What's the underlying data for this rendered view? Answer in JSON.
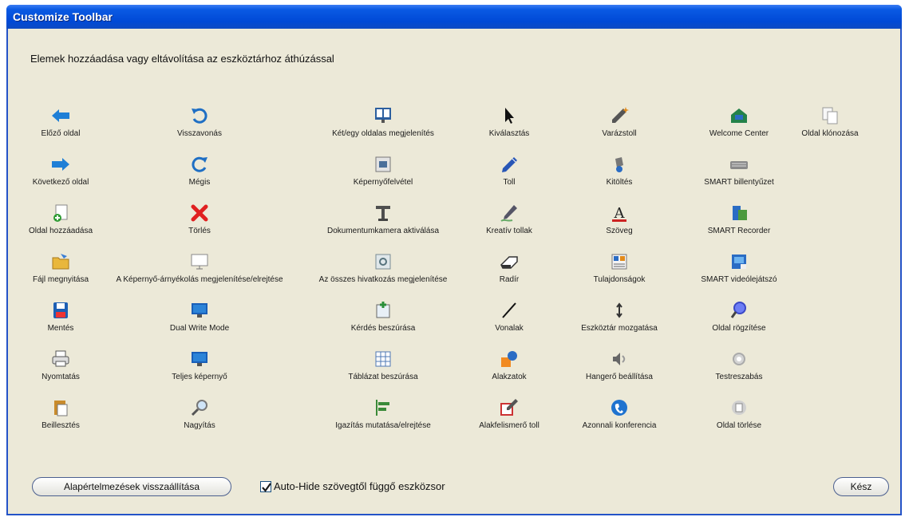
{
  "window": {
    "title": "Customize Toolbar"
  },
  "instruction": "Elemek hozzáadása vagy eltávolítása az eszköztárhoz áthúzással",
  "columns": [
    [
      {
        "label": "Előző oldal",
        "icon": "arrow-left-icon"
      },
      {
        "label": "Következő oldal",
        "icon": "arrow-right-icon"
      },
      {
        "label": "Oldal hozzáadása",
        "icon": "add-page-icon"
      },
      {
        "label": "Fájl megnyitása",
        "icon": "open-folder-icon"
      },
      {
        "label": "Mentés",
        "icon": "save-icon"
      },
      {
        "label": "Nyomtatás",
        "icon": "printer-icon"
      },
      {
        "label": "Beillesztés",
        "icon": "paste-icon"
      }
    ],
    [
      {
        "label": "Visszavonás",
        "icon": "undo-icon"
      },
      {
        "label": "Mégis",
        "icon": "redo-icon"
      },
      {
        "label": "Törlés",
        "icon": "delete-x-icon"
      },
      {
        "label": "A Képernyő-árnyékolás megjelenítése/elrejtése",
        "icon": "screen-shade-icon"
      },
      {
        "label": "Dual Write Mode",
        "icon": "dual-monitor-icon"
      },
      {
        "label": "Teljes képernyő",
        "icon": "full-screen-icon"
      },
      {
        "label": "Nagyítás",
        "icon": "magnifier-icon"
      }
    ],
    [
      {
        "label": "Két/egy oldalas megjelenítés",
        "icon": "dual-page-display-icon"
      },
      {
        "label": "Képernyőfelvétel",
        "icon": "screen-capture-icon"
      },
      {
        "label": "Dokumentumkamera aktiválása",
        "icon": "document-camera-icon"
      },
      {
        "label": "Az összes hivatkozás megjelenítése",
        "icon": "show-links-icon"
      },
      {
        "label": "Kérdés beszúrása",
        "icon": "insert-question-icon"
      },
      {
        "label": "Táblázat beszúrása",
        "icon": "insert-table-icon"
      },
      {
        "label": "Igazítás mutatása/elrejtése",
        "icon": "alignment-icon"
      }
    ],
    [
      {
        "label": "Kiválasztás",
        "icon": "select-arrow-icon"
      },
      {
        "label": "Toll",
        "icon": "pen-icon"
      },
      {
        "label": "Kreatív tollak",
        "icon": "creative-pen-icon"
      },
      {
        "label": "Radír",
        "icon": "eraser-icon"
      },
      {
        "label": "Vonalak",
        "icon": "line-icon"
      },
      {
        "label": "Alakzatok",
        "icon": "shapes-icon"
      },
      {
        "label": "Alakfelismerő toll",
        "icon": "shape-recognition-pen-icon"
      }
    ],
    [
      {
        "label": "Varázstoll",
        "icon": "magic-pen-icon"
      },
      {
        "label": "Kitöltés",
        "icon": "fill-icon"
      },
      {
        "label": "Szöveg",
        "icon": "text-icon"
      },
      {
        "label": "Tulajdonságok",
        "icon": "properties-icon"
      },
      {
        "label": "Eszköztár mozgatása",
        "icon": "move-toolbar-icon"
      },
      {
        "label": "Hangerő beállítása",
        "icon": "volume-icon"
      },
      {
        "label": "Azonnali konferencia",
        "icon": "instant-conference-icon"
      }
    ],
    [
      {
        "label": "Welcome Center",
        "icon": "welcome-center-icon"
      },
      {
        "label": "SMART billentyűzet",
        "icon": "keyboard-icon"
      },
      {
        "label": "SMART Recorder",
        "icon": "recorder-icon"
      },
      {
        "label": "SMART videólejátszó",
        "icon": "video-player-icon"
      },
      {
        "label": "Oldal rögzítése",
        "icon": "pin-page-icon"
      },
      {
        "label": "Testreszabás",
        "icon": "customize-gear-icon"
      },
      {
        "label": "Oldal törlése",
        "icon": "delete-page-icon"
      }
    ],
    [
      {
        "label": "Oldal klónozása",
        "icon": "clone-page-icon"
      }
    ]
  ],
  "footer": {
    "reset_label": "Alapértelmezések visszaállítása",
    "auto_hide_label": "Auto-Hide szövegtől függő eszközsor",
    "auto_hide_checked": true,
    "done_label": "Kész"
  }
}
